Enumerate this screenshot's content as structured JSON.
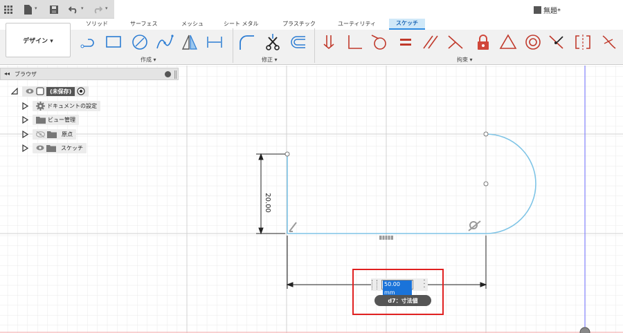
{
  "document": {
    "title": "無題*"
  },
  "ribbon": {
    "tabs": [
      "ソリッド",
      "サーフェス",
      "メッシュ",
      "シート メタル",
      "プラスチック",
      "ユーティリティ",
      "スケッチ"
    ],
    "active_tab": "スケッチ",
    "workspace_button": "デザイン ▾",
    "groups": {
      "create": "作成 ▾",
      "modify": "修正 ▾",
      "constraints": "拘束 ▾"
    }
  },
  "browser": {
    "title": "ブラウザ",
    "root": "(未保存)",
    "items": [
      "ドキュメントの設定",
      "ビュー管理",
      "原点",
      "スケッチ"
    ]
  },
  "sketch": {
    "vertical_dimension": "20.00",
    "dimension_input_value": "50.00 mm",
    "dimension_tooltip": "d7：寸法値"
  },
  "colors": {
    "sketch_line": "#7ec4e6",
    "accent": "#2c8be3",
    "highlight": "#e02020",
    "constraint_red": "#c0392b"
  }
}
